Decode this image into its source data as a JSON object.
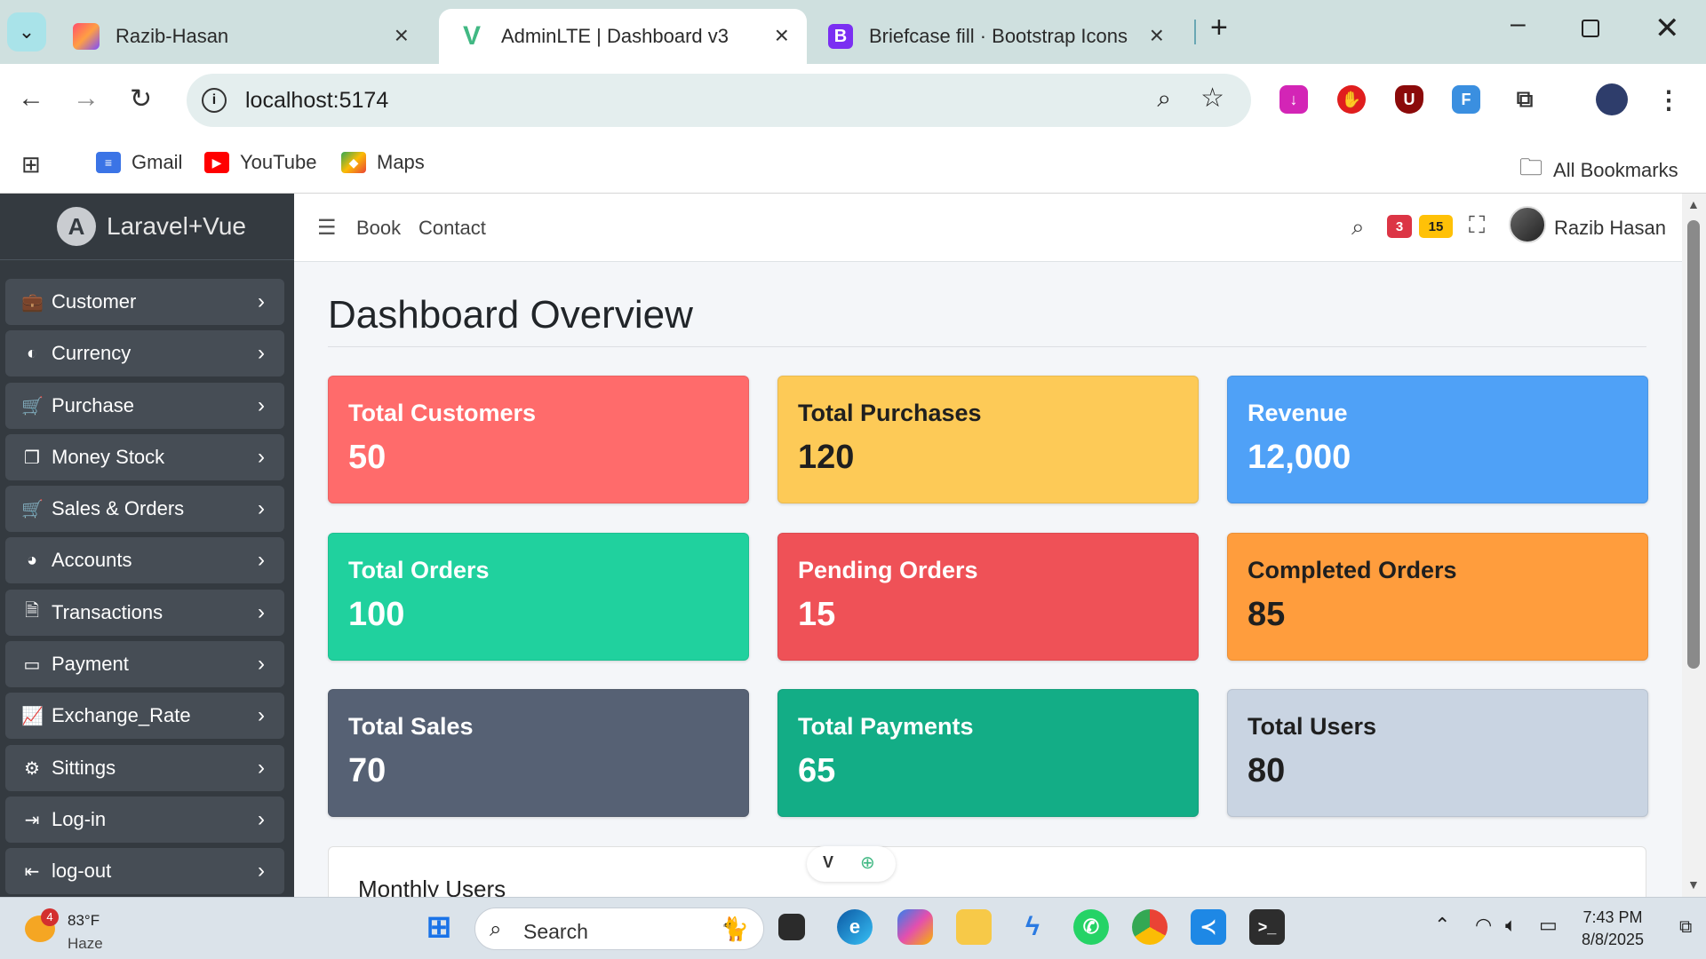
{
  "browser": {
    "tabs": [
      {
        "title": "Razib-Hasan",
        "active": false
      },
      {
        "title": "AdminLTE | Dashboard v3",
        "active": true
      },
      {
        "title": "Briefcase fill · Bootstrap Icons",
        "active": false
      }
    ],
    "url": "localhost:5174",
    "bookmarks": [
      "Gmail",
      "YouTube",
      "Maps"
    ],
    "all_bookmarks_label": "All Bookmarks"
  },
  "sidebar": {
    "brand": "Laravel+Vue",
    "items": [
      {
        "label": "Customer",
        "icon": "briefcase-icon"
      },
      {
        "label": "Currency",
        "icon": "palette-icon"
      },
      {
        "label": "Purchase",
        "icon": "cart-icon"
      },
      {
        "label": "Money Stock",
        "icon": "files-icon"
      },
      {
        "label": "Sales & Orders",
        "icon": "cart-icon"
      },
      {
        "label": "Accounts",
        "icon": "pie-chart-icon"
      },
      {
        "label": "Transactions",
        "icon": "document-icon"
      },
      {
        "label": "Payment",
        "icon": "credit-card-icon"
      },
      {
        "label": "Exchange_Rate",
        "icon": "line-chart-icon"
      },
      {
        "label": "Sittings",
        "icon": "gear-icon"
      },
      {
        "label": "Log-in",
        "icon": "login-icon"
      },
      {
        "label": "log-out",
        "icon": "logout-icon"
      }
    ]
  },
  "topnav": {
    "links": [
      "Book",
      "Contact"
    ],
    "badge_red": "3",
    "badge_yellow": "15",
    "user_name": "Razib Hasan"
  },
  "main": {
    "title": "Dashboard Overview",
    "cards": [
      {
        "label": "Total Customers",
        "value": "50",
        "bg": "#ff6b6b",
        "fg": "#ffffff"
      },
      {
        "label": "Total Purchases",
        "value": "120",
        "bg": "#fdca57",
        "fg": "#1f1f1f"
      },
      {
        "label": "Revenue",
        "value": "12,000",
        "bg": "#4fa1f7",
        "fg": "#ffffff"
      },
      {
        "label": "Total Orders",
        "value": "100",
        "bg": "#20d19e",
        "fg": "#ffffff"
      },
      {
        "label": "Pending Orders",
        "value": "15",
        "bg": "#ef5157",
        "fg": "#ffffff"
      },
      {
        "label": "Completed Orders",
        "value": "85",
        "bg": "#ff9d3d",
        "fg": "#1f1f1f"
      },
      {
        "label": "Total Sales",
        "value": "70",
        "bg": "#566174",
        "fg": "#ffffff"
      },
      {
        "label": "Total Payments",
        "value": "65",
        "bg": "#13ad86",
        "fg": "#ffffff"
      },
      {
        "label": "Total Users",
        "value": "80",
        "bg": "#c9d4e2",
        "fg": "#1f1f1f"
      }
    ],
    "monthly_title": "Monthly Users"
  },
  "taskbar": {
    "weather_badge": "4",
    "temperature": "83°F",
    "condition": "Haze",
    "search_placeholder": "Search",
    "time": "7:43 PM",
    "date": "8/8/2025"
  }
}
